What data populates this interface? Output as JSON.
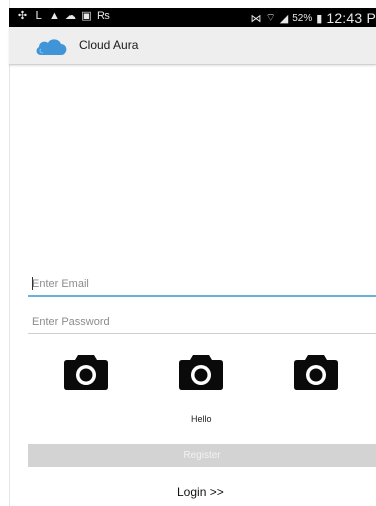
{
  "status_bar": {
    "left_icons": [
      "usb-icon",
      "notification-icon",
      "warning-icon",
      "cloud-icon",
      "image-icon",
      "document-icon"
    ],
    "right_icons": [
      "mute-icon",
      "wifi-icon",
      "signal-icon"
    ],
    "battery": "52%",
    "time": "12:43 P"
  },
  "app_bar": {
    "title": "Cloud Aura",
    "logo_color": "#3f95d8"
  },
  "form": {
    "email_placeholder": "Enter Email",
    "email_value": "",
    "password_placeholder": "Enter Password",
    "password_value": ""
  },
  "camera_buttons": [
    "camera-icon",
    "camera-icon",
    "camera-icon"
  ],
  "caption": "Hello",
  "register_label": "Register",
  "login_label": "Login >>",
  "colors": {
    "accent": "#6ab2d9",
    "button_disabled": "#d3d3d3",
    "app_bar": "#eeeeee",
    "status_bar": "#000000"
  }
}
